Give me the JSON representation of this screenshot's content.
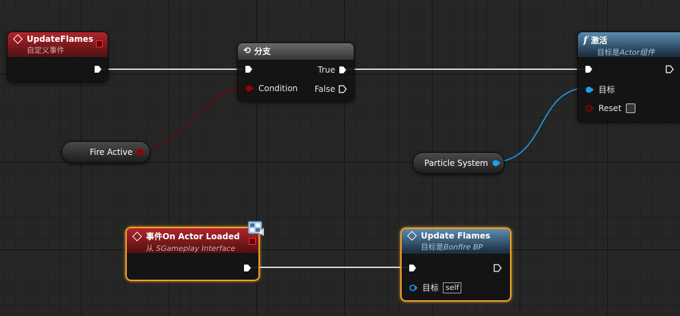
{
  "nodes": {
    "update_flames_event": {
      "title": "UpdateFlames",
      "subtitle": "自定义事件"
    },
    "branch": {
      "title": "分支",
      "true_label": "True",
      "condition_label": "Condition",
      "false_label": "False"
    },
    "activate": {
      "title": "激活",
      "subtitle_prefix": "目标是",
      "subtitle_target": "Actor组件",
      "target_label": "目标",
      "reset_label": "Reset"
    },
    "fire_active": {
      "label": "Fire Active"
    },
    "particle_system": {
      "label": "Particle System"
    },
    "on_actor_loaded": {
      "title": "事件On Actor Loaded",
      "subtitle_prefix": "从",
      "subtitle_target": "SGameplay Interface"
    },
    "update_flames_call": {
      "title": "Update Flames",
      "subtitle_prefix": "目标是",
      "subtitle_target": "Bonfire BP",
      "target_label": "目标",
      "self_label": "self"
    }
  },
  "colors": {
    "exec_wire": "#ffffff",
    "bool_pin": "#8c0000",
    "object_pin": "#00a8f0",
    "event_header": "#b0252a",
    "function_header": "#5b8cb0",
    "selection": "#f3a32a"
  },
  "icons": [
    "event-diamond-icon",
    "branch-icon",
    "function-f-icon",
    "interface-badge-icon",
    "exec-pin-icon",
    "delegate-pin-icon"
  ]
}
